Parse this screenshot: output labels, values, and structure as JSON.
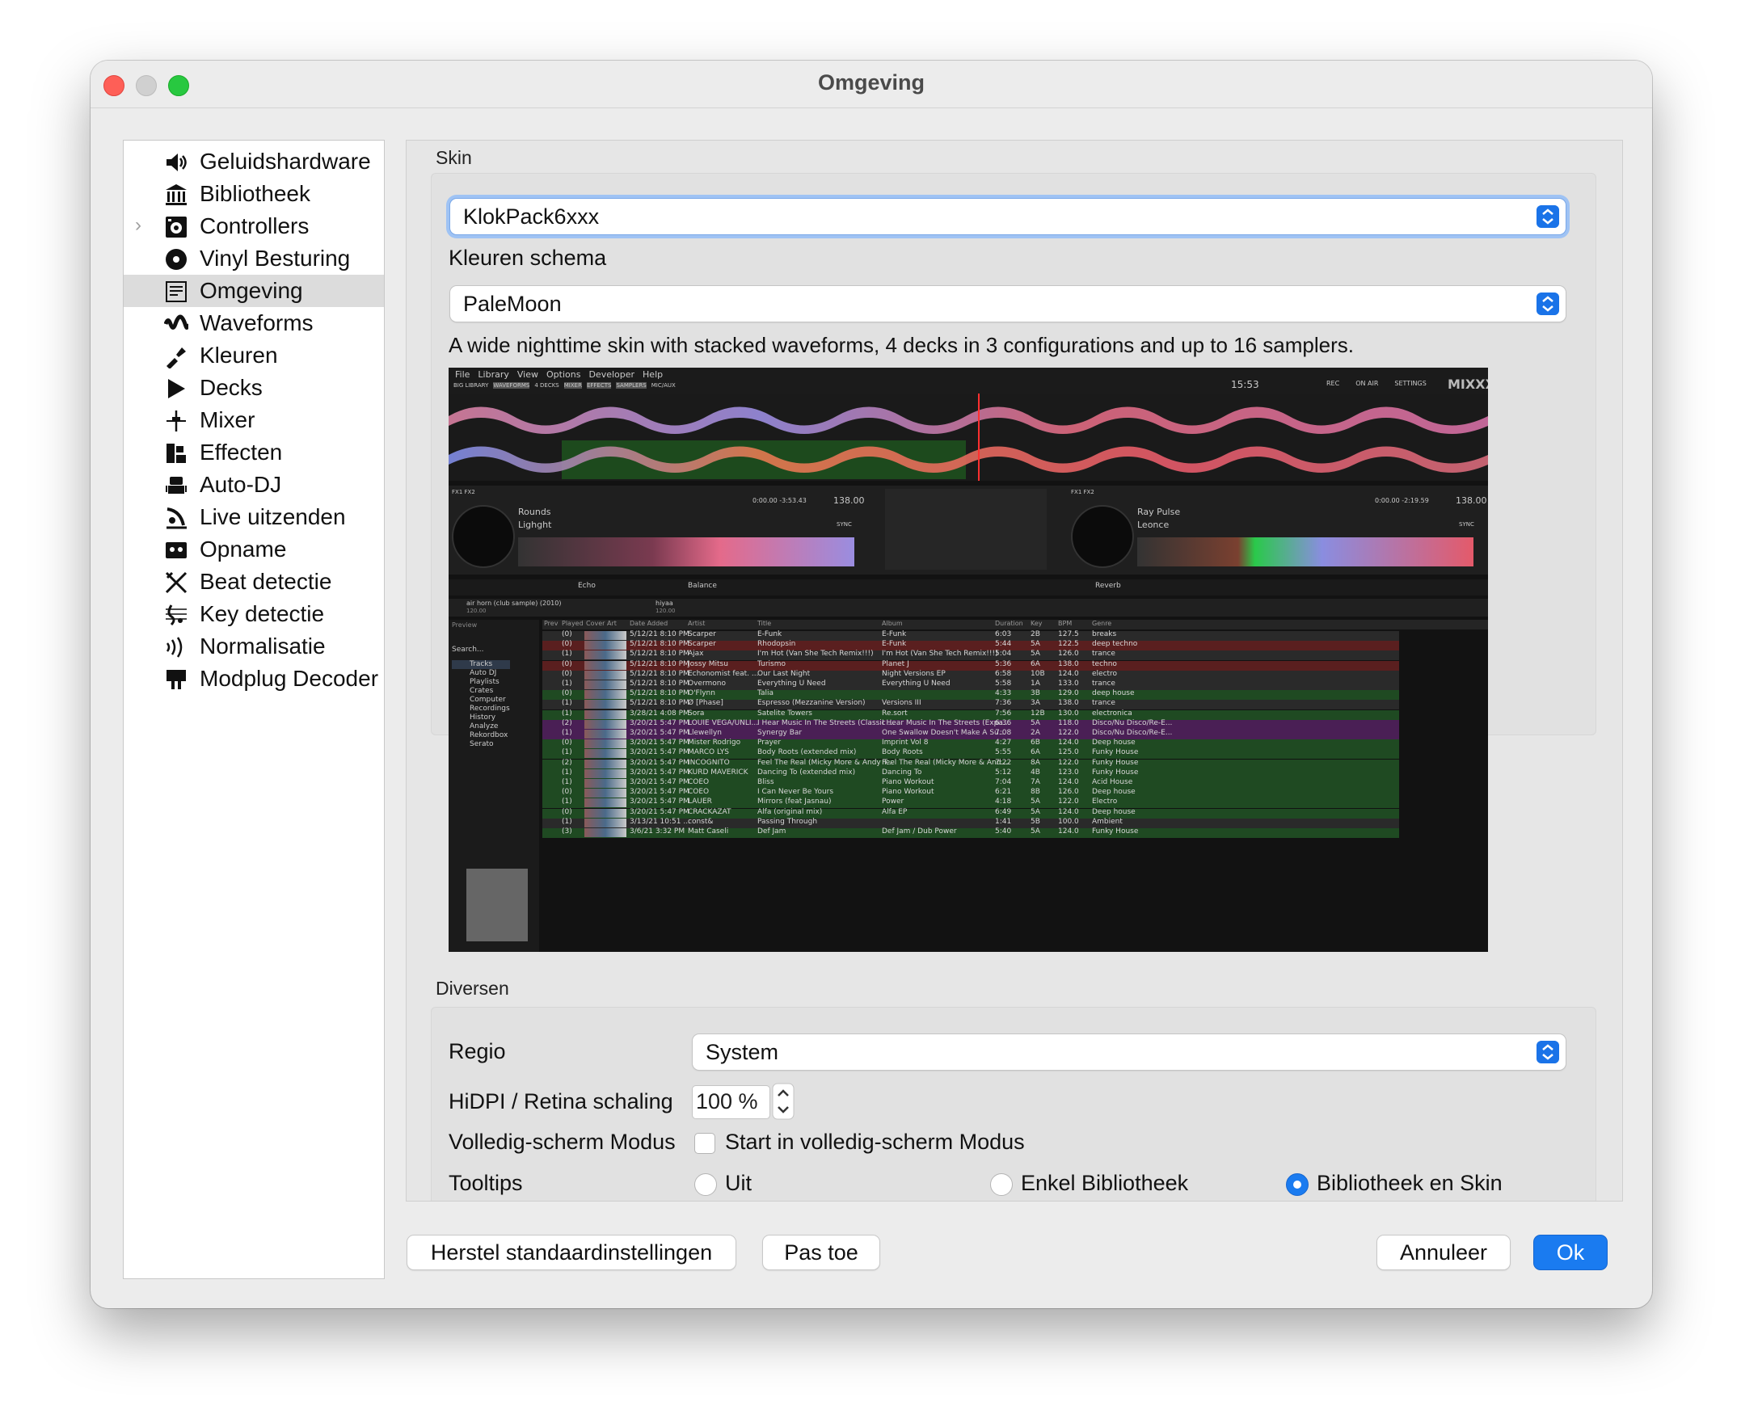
{
  "window": {
    "title": "Omgeving"
  },
  "sidebar": {
    "items": [
      {
        "label": "Geluidshardware",
        "icon": "speaker-icon"
      },
      {
        "label": "Bibliotheek",
        "icon": "library-icon"
      },
      {
        "label": "Controllers",
        "icon": "controller-icon",
        "expandable": true
      },
      {
        "label": "Vinyl Besturing",
        "icon": "vinyl-icon"
      },
      {
        "label": "Omgeving",
        "icon": "interface-icon",
        "selected": true
      },
      {
        "label": "Waveforms",
        "icon": "waveform-icon"
      },
      {
        "label": "Kleuren",
        "icon": "palette-icon"
      },
      {
        "label": "Decks",
        "icon": "play-icon"
      },
      {
        "label": "Mixer",
        "icon": "mixer-icon"
      },
      {
        "label": "Effecten",
        "icon": "effects-icon"
      },
      {
        "label": "Auto-DJ",
        "icon": "robot-icon"
      },
      {
        "label": "Live uitzenden",
        "icon": "broadcast-icon"
      },
      {
        "label": "Opname",
        "icon": "cassette-icon"
      },
      {
        "label": "Beat detectie",
        "icon": "beat-icon"
      },
      {
        "label": "Key detectie",
        "icon": "key-icon"
      },
      {
        "label": "Normalisatie",
        "icon": "normalize-icon"
      },
      {
        "label": "Modplug Decoder",
        "icon": "modplug-icon"
      }
    ]
  },
  "skin": {
    "group_title": "Skin",
    "selected": "KlokPack6xxx",
    "color_scheme_label": "Kleuren schema",
    "color_scheme": "PaleMoon",
    "description": "A wide nighttime skin with stacked waveforms, 4 decks in 3 configurations and up to 16 samplers."
  },
  "preview": {
    "menu": [
      "File",
      "Library",
      "View",
      "Options",
      "Developer",
      "Help"
    ],
    "toolbar": [
      "BIG LIBRARY",
      "WAVEFORMS",
      "4 DECKS",
      "MIXER",
      "EFFECTS",
      "SAMPLERS",
      "MIC/AUX"
    ],
    "time": "15:53",
    "right_controls": [
      "REC",
      "ON AIR",
      "SETTINGS"
    ],
    "logo": "MIXXX",
    "deck1": {
      "fx": "FX1  FX2",
      "title": "Rounds",
      "artist": "Lighght",
      "bpm": "138.00",
      "time": "0:00.00  -3:53.43",
      "sync": "SYNC",
      "effect": "Echo",
      "effect2": "Balance"
    },
    "deck2": {
      "fx": "FX1  FX2",
      "title": "Ray Pulse",
      "artist": "Leonce",
      "bpm": "138.00",
      "time": "0:00.00  -2:19.59",
      "sync": "SYNC",
      "effect": "Reverb"
    },
    "sampler1": {
      "title": "air horn (club sample) (2010)",
      "bpm": "120.00"
    },
    "sampler2": {
      "title": "hiyaa",
      "bpm": "120.00"
    },
    "lib_tree_header": "Preview",
    "search": "Search...",
    "tree": [
      "Tracks",
      "Auto DJ",
      "Playlists",
      "Crates",
      "Computer",
      "Recordings",
      "History",
      "Analyze",
      "Rekordbox",
      "Serato"
    ],
    "columns": [
      "Prev",
      "Played",
      "Cover Art",
      "Date Added",
      "Artist",
      "Title",
      "Album",
      "Duration",
      "Key",
      "BPM",
      "Genre"
    ],
    "rows": [
      {
        "played": "(0)",
        "date": "5/12/21 8:10 PM",
        "artist": "Scarper",
        "title": "E-Funk",
        "album": "E-Funk",
        "dur": "6:03",
        "key": "2B",
        "bpm": "127.5",
        "genre": "breaks",
        "color": "#2a2a2a"
      },
      {
        "played": "(0)",
        "date": "5/12/21 8:10 PM",
        "artist": "Scarper",
        "title": "Rhodopsin",
        "album": "E-Funk",
        "dur": "5:44",
        "key": "5A",
        "bpm": "122.5",
        "genre": "deep techno",
        "color": "#5a1f1f"
      },
      {
        "played": "(1)",
        "date": "5/12/21 8:10 PM",
        "artist": "Ajax",
        "title": "I'm Hot (Van She Tech Remix!!!)",
        "album": "I'm Hot (Van She Tech Remix!!!)",
        "dur": "5:04",
        "key": "5A",
        "bpm": "126.0",
        "genre": "trance",
        "color": "#2a2a2a"
      },
      {
        "played": "(0)",
        "date": "5/12/21 8:10 PM",
        "artist": "Jossy Mitsu",
        "title": "Turismo",
        "album": "Planet J",
        "dur": "5:36",
        "key": "6A",
        "bpm": "138.0",
        "genre": "techno",
        "color": "#5a1f1f"
      },
      {
        "played": "(0)",
        "date": "5/12/21 8:10 PM",
        "artist": "Echonomist feat. ...",
        "title": "Our Last Night",
        "album": "Night Versions EP",
        "dur": "6:58",
        "key": "10B",
        "bpm": "124.0",
        "genre": "electro",
        "color": "#2a2a2a"
      },
      {
        "played": "(1)",
        "date": "5/12/21 8:10 PM",
        "artist": "Overmono",
        "title": "Everything U Need",
        "album": "Everything U Need",
        "dur": "5:58",
        "key": "1A",
        "bpm": "133.0",
        "genre": "trance",
        "color": "#2a2a2a"
      },
      {
        "played": "(0)",
        "date": "5/12/21 8:10 PM",
        "artist": "O'Flynn",
        "title": "Talia",
        "album": "",
        "dur": "4:33",
        "key": "3B",
        "bpm": "129.0",
        "genre": "deep house",
        "color": "#1f4a22"
      },
      {
        "played": "(1)",
        "date": "5/12/21 8:10 PM",
        "artist": "Ø [Phase]",
        "title": "Espresso (Mezzanine Version)",
        "album": "Versions III",
        "dur": "7:36",
        "key": "3A",
        "bpm": "138.0",
        "genre": "trance",
        "color": "#2a2a2a"
      },
      {
        "played": "(1)",
        "date": "3/28/21 4:08 PM",
        "artist": "Sora",
        "title": "Satelite Towers",
        "album": "Re.sort",
        "dur": "7:56",
        "key": "12B",
        "bpm": "130.0",
        "genre": "electronica",
        "color": "#1f4a22"
      },
      {
        "played": "(2)",
        "date": "3/20/21 5:47 PM",
        "artist": "LOUIE VEGA/UNLI...",
        "title": "I Hear Music In The Streets (Classic ...",
        "album": "I Hear Music In The Streets (Expa...",
        "dur": "6:36",
        "key": "5A",
        "bpm": "118.0",
        "genre": "Disco/Nu Disco/Re-E...",
        "color": "#4a1f55"
      },
      {
        "played": "(1)",
        "date": "3/20/21 5:47 PM",
        "artist": "Llewellyn",
        "title": "Synergy Bar",
        "album": "One Swallow Doesn't Make A Su...",
        "dur": "7:08",
        "key": "2A",
        "bpm": "122.0",
        "genre": "Disco/Nu Disco/Re-E...",
        "color": "#4a1f55"
      },
      {
        "played": "(0)",
        "date": "3/20/21 5:47 PM",
        "artist": "Mister Rodrigo",
        "title": "Prayer",
        "album": "Imprint Vol 8",
        "dur": "4:27",
        "key": "6B",
        "bpm": "124.0",
        "genre": "Deep house",
        "color": "#1f4a22"
      },
      {
        "played": "(1)",
        "date": "3/20/21 5:47 PM",
        "artist": "MARCO LYS",
        "title": "Body Roots (extended mix)",
        "album": "Body Roots",
        "dur": "5:55",
        "key": "6A",
        "bpm": "125.0",
        "genre": "Funky House",
        "color": "#1f4a22"
      },
      {
        "played": "(2)",
        "date": "3/20/21 5:47 PM",
        "artist": "INCOGNITO",
        "title": "Feel The Real (Micky More & Andy T...",
        "album": "Feel The Real (Micky More & And...",
        "dur": "7:22",
        "key": "8A",
        "bpm": "122.0",
        "genre": "Funky House",
        "color": "#1f4a22"
      },
      {
        "played": "(1)",
        "date": "3/20/21 5:47 PM",
        "artist": "KURD MAVERICK",
        "title": "Dancing To (extended mix)",
        "album": "Dancing To",
        "dur": "5:12",
        "key": "4B",
        "bpm": "123.0",
        "genre": "Funky House",
        "color": "#1f4a22"
      },
      {
        "played": "(1)",
        "date": "3/20/21 5:47 PM",
        "artist": "COEO",
        "title": "Bliss",
        "album": "Piano Workout",
        "dur": "7:04",
        "key": "7A",
        "bpm": "124.0",
        "genre": "Acid House",
        "color": "#1f4a22"
      },
      {
        "played": "(0)",
        "date": "3/20/21 5:47 PM",
        "artist": "COEO",
        "title": "I Can Never Be Yours",
        "album": "Piano Workout",
        "dur": "6:21",
        "key": "8B",
        "bpm": "126.0",
        "genre": "Deep house",
        "color": "#1f4a22"
      },
      {
        "played": "(1)",
        "date": "3/20/21 5:47 PM",
        "artist": "LAUER",
        "title": "Mirrors (feat Jasnau)",
        "album": "Power",
        "dur": "4:18",
        "key": "5A",
        "bpm": "122.0",
        "genre": "Electro",
        "color": "#1f4a22"
      },
      {
        "played": "(0)",
        "date": "3/20/21 5:47 PM",
        "artist": "CRACKAZAT",
        "title": "Alfa (original mix)",
        "album": "Alfa EP",
        "dur": "6:49",
        "key": "5A",
        "bpm": "124.0",
        "genre": "Deep house",
        "color": "#1f4a22"
      },
      {
        "played": "(1)",
        "date": "3/13/21 10:51 ...",
        "artist": "const&",
        "title": "Passing Through",
        "album": "",
        "dur": "1:41",
        "key": "5B",
        "bpm": "100.0",
        "genre": "Ambient",
        "color": "#2a2a2a"
      },
      {
        "played": "(3)",
        "date": "3/6/21 3:32 PM",
        "artist": "Matt Caseli",
        "title": "Def Jam",
        "album": "Def Jam / Dub Power",
        "dur": "5:40",
        "key": "5A",
        "bpm": "124.0",
        "genre": "Funky House",
        "color": "#1f4a22"
      }
    ]
  },
  "misc": {
    "group_title": "Diversen",
    "region_label": "Regio",
    "region_value": "System",
    "hidpi_label": "HiDPI / Retina schaling",
    "hidpi_value": "100 %",
    "fullscreen_label": "Volledig-scherm Modus",
    "fullscreen_checkbox": "Start in volledig-scherm Modus",
    "fullscreen_checked": false,
    "tooltips_label": "Tooltips",
    "tooltip_options": [
      "Uit",
      "Enkel Bibliotheek",
      "Bibliotheek en Skin"
    ],
    "tooltip_selected": "Bibliotheek en Skin"
  },
  "buttons": {
    "reset": "Herstel standaardinstellingen",
    "apply": "Pas toe",
    "cancel": "Annuleer",
    "ok": "Ok"
  },
  "colors": {
    "accent": "#1a7bf0",
    "close": "#fe5f57",
    "maximize": "#28c840"
  }
}
